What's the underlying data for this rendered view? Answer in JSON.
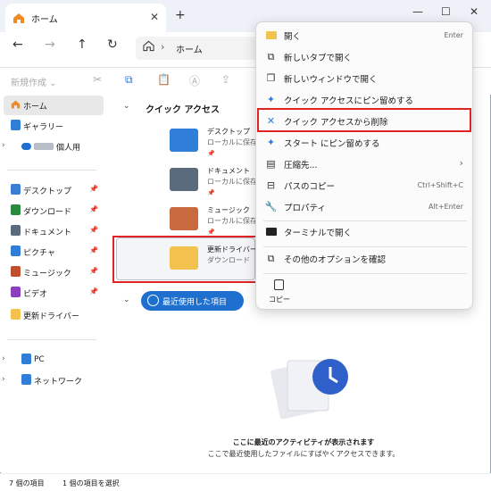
{
  "window": {
    "tab_title": "ホーム",
    "new_tab": "+",
    "minimize": "—",
    "maximize": "☐",
    "close": "✕"
  },
  "nav": {
    "back": "←",
    "forward": "→",
    "up": "↑",
    "refresh": "↻",
    "address": "ホーム",
    "sep": "›"
  },
  "toolbar": {
    "new_label": "新規作成 ⌄"
  },
  "sidebar": {
    "home": "ホーム",
    "gallery": "ギャラリー",
    "personal": "個人用",
    "pinned": [
      {
        "label": "デスクトップ",
        "color": "#3b7fd4"
      },
      {
        "label": "ダウンロード",
        "color": "#2a8b3f"
      },
      {
        "label": "ドキュメント",
        "color": "#5a6b7d"
      },
      {
        "label": "ピクチャ",
        "color": "#2f7fd8"
      },
      {
        "label": "ミュージック",
        "color": "#c0502f"
      },
      {
        "label": "ビデオ",
        "color": "#8a3fbf"
      }
    ],
    "extra": "更新ドライバー",
    "pc": "PC",
    "network": "ネットワーク",
    "pin_glyph": "📌"
  },
  "main": {
    "quick_title": "クイック アクセス",
    "recent_label": "最近使用した項目",
    "items": [
      {
        "name": "デスクトップ",
        "sub": "ローカルに保存済",
        "pin": "📌",
        "color": "#2f7fd8"
      },
      {
        "name": "ドキュメント",
        "sub": "ローカルに保存済",
        "pin": "📌",
        "color": "#5a6b7d"
      },
      {
        "name": "ミュージック",
        "sub": "ローカルに保存済",
        "pin": "📌",
        "color": "#c86a3e"
      },
      {
        "name": "更新ドライバー",
        "sub": "ダウンロード",
        "pin": "",
        "color": "#f2c14e"
      }
    ],
    "empty_1": "ここに最近のアクティビティが表示されます",
    "empty_2": "ここで最近使用したファイルにすばやくアクセスできます。"
  },
  "status": {
    "count": "7 個の項目",
    "selected": "1 個の項目を選択"
  },
  "context_menu": {
    "items": [
      {
        "label": "開く",
        "shortcut": "Enter",
        "icon": "folder-icon"
      },
      {
        "label": "新しいタブで開く",
        "shortcut": "",
        "icon": "new-tab-icon"
      },
      {
        "label": "新しいウィンドウで開く",
        "shortcut": "",
        "icon": "new-window-icon"
      },
      {
        "label": "クイック アクセスにピン留めする",
        "shortcut": "",
        "icon": "pin-icon"
      },
      {
        "label": "クイック アクセスから削除",
        "shortcut": "",
        "icon": "unpin-icon"
      },
      {
        "label": "スタート にピン留めする",
        "shortcut": "",
        "icon": "pin-start-icon"
      },
      {
        "label": "圧縮先...",
        "shortcut": "›",
        "icon": "archive-icon"
      },
      {
        "label": "パスのコピー",
        "shortcut": "Ctrl+Shift+C",
        "icon": "path-icon"
      },
      {
        "label": "プロパティ",
        "shortcut": "Alt+Enter",
        "icon": "wrench-icon"
      },
      {
        "label": "ターミナルで開く",
        "shortcut": "",
        "icon": "terminal-icon"
      },
      {
        "label": "その他のオプションを確認",
        "shortcut": "",
        "icon": "more-options-icon"
      }
    ],
    "copy_label": "コピー"
  },
  "colors": {
    "accent": "#1f6fcf",
    "highlight": "#e02424"
  }
}
